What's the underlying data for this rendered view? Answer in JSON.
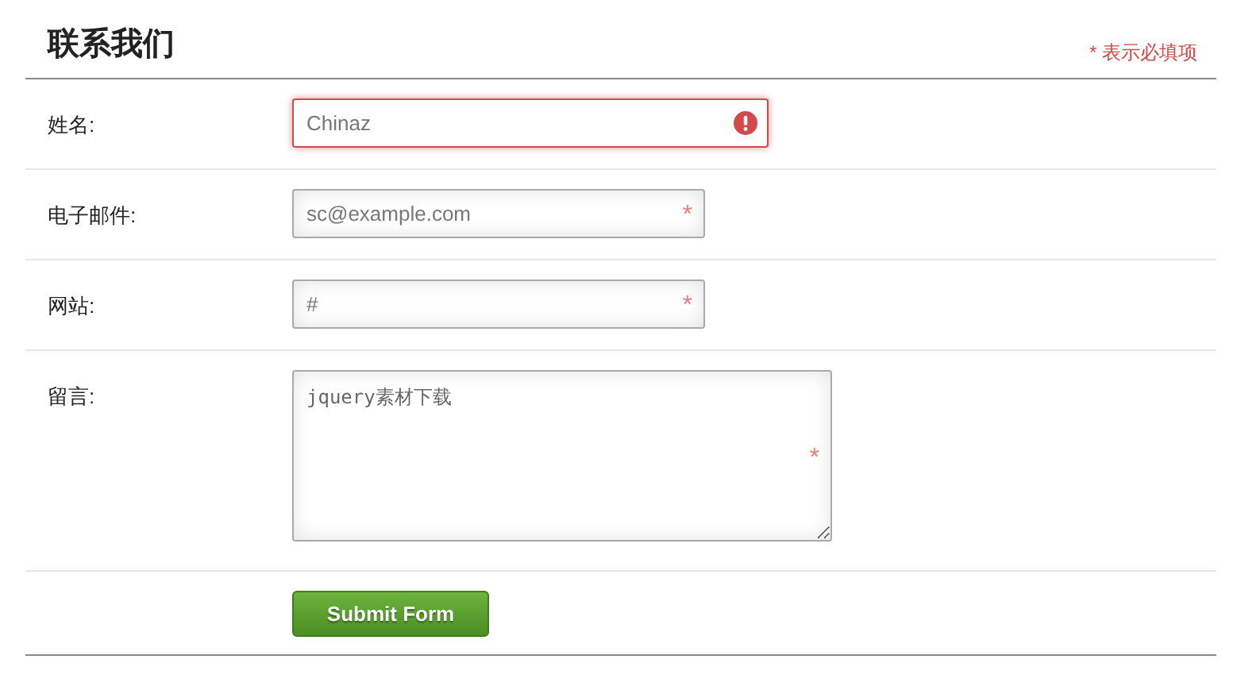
{
  "title": "联系我们",
  "required_note": "* 表示必填项",
  "fields": [
    {
      "label": "姓名:",
      "kind": "input",
      "placeholder": "Chinaz",
      "invalid": true
    },
    {
      "label": "电子邮件:",
      "kind": "input",
      "placeholder": "sc@example.com",
      "invalid": false,
      "required_mark": "*"
    },
    {
      "label": "网站:",
      "kind": "input",
      "placeholder": "#",
      "invalid": false,
      "required_mark": "*"
    },
    {
      "label": "留言:",
      "kind": "textarea",
      "placeholder": "jquery素材下载",
      "invalid": false,
      "required_mark": "*"
    }
  ],
  "submit": {
    "label": "Submit Form"
  }
}
